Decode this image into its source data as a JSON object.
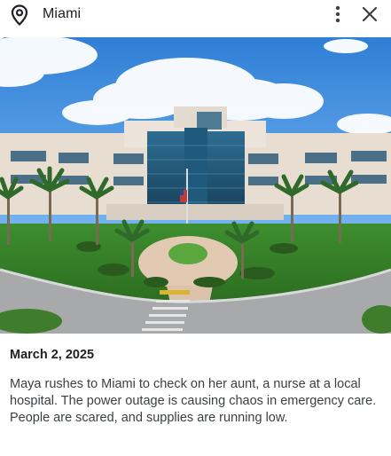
{
  "header": {
    "title": "Miami",
    "location_icon": "map-pin-icon",
    "menu_icon": "more-vert-icon",
    "close_icon": "close-icon"
  },
  "photo": {
    "subject": "hospital-photo"
  },
  "entry": {
    "date": "March 2, 2025",
    "description": "Maya rushes to Miami to check on her aunt, a nurse at a local hospital. The power outage is causing chaos in emergency care. People are scared, and supplies are running low."
  },
  "colors": {
    "text_primary": "#202124",
    "text_secondary": "#3c4043",
    "icon": "#3c4043"
  }
}
